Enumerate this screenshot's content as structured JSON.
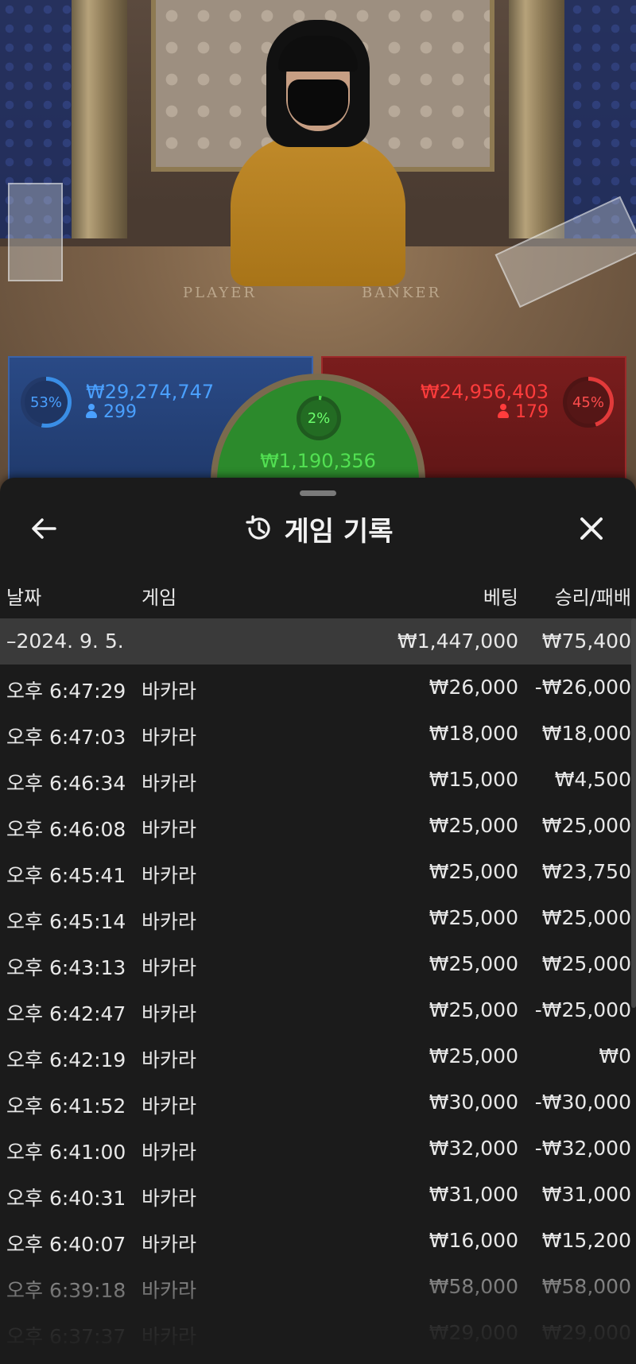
{
  "video": {
    "table_labels": [
      "PLAYER",
      "BANKER"
    ]
  },
  "bets": {
    "player": {
      "percent": "53%",
      "amount": "₩29,274,747",
      "players": "299",
      "color": "#4aa0ff"
    },
    "tie": {
      "percent": "2%",
      "amount": "₩1,190,356",
      "color": "#52e052"
    },
    "banker": {
      "percent": "45%",
      "amount": "₩24,956,403",
      "players": "179",
      "color": "#ff3c3c"
    }
  },
  "sheet": {
    "back_icon": "arrow-left-icon",
    "history_icon": "history-icon",
    "title": "게임 기록",
    "close_icon": "close-icon",
    "columns": {
      "date": "날짜",
      "game": "게임",
      "bet": "베팅",
      "result": "승리/패배"
    },
    "date_group": {
      "label": "–2024. 9. 5.",
      "bet": "₩1,447,000",
      "result": "₩75,400"
    },
    "rows": [
      {
        "time": "오후 6:47:29",
        "game": "바카라",
        "bet": "₩26,000",
        "result": "-₩26,000"
      },
      {
        "time": "오후 6:47:03",
        "game": "바카라",
        "bet": "₩18,000",
        "result": "₩18,000"
      },
      {
        "time": "오후 6:46:34",
        "game": "바카라",
        "bet": "₩15,000",
        "result": "₩4,500"
      },
      {
        "time": "오후 6:46:08",
        "game": "바카라",
        "bet": "₩25,000",
        "result": "₩25,000"
      },
      {
        "time": "오후 6:45:41",
        "game": "바카라",
        "bet": "₩25,000",
        "result": "₩23,750"
      },
      {
        "time": "오후 6:45:14",
        "game": "바카라",
        "bet": "₩25,000",
        "result": "₩25,000"
      },
      {
        "time": "오후 6:43:13",
        "game": "바카라",
        "bet": "₩25,000",
        "result": "₩25,000"
      },
      {
        "time": "오후 6:42:47",
        "game": "바카라",
        "bet": "₩25,000",
        "result": "-₩25,000"
      },
      {
        "time": "오후 6:42:19",
        "game": "바카라",
        "bet": "₩25,000",
        "result": "₩0"
      },
      {
        "time": "오후 6:41:52",
        "game": "바카라",
        "bet": "₩30,000",
        "result": "-₩30,000"
      },
      {
        "time": "오후 6:41:00",
        "game": "바카라",
        "bet": "₩32,000",
        "result": "-₩32,000"
      },
      {
        "time": "오후 6:40:31",
        "game": "바카라",
        "bet": "₩31,000",
        "result": "₩31,000"
      },
      {
        "time": "오후 6:40:07",
        "game": "바카라",
        "bet": "₩16,000",
        "result": "₩15,200"
      },
      {
        "time": "오후 6:39:18",
        "game": "바카라",
        "bet": "₩58,000",
        "result": "₩58,000"
      },
      {
        "time": "오후 6:37:37",
        "game": "바카라",
        "bet": "₩29,000",
        "result": "₩29,000"
      }
    ]
  }
}
